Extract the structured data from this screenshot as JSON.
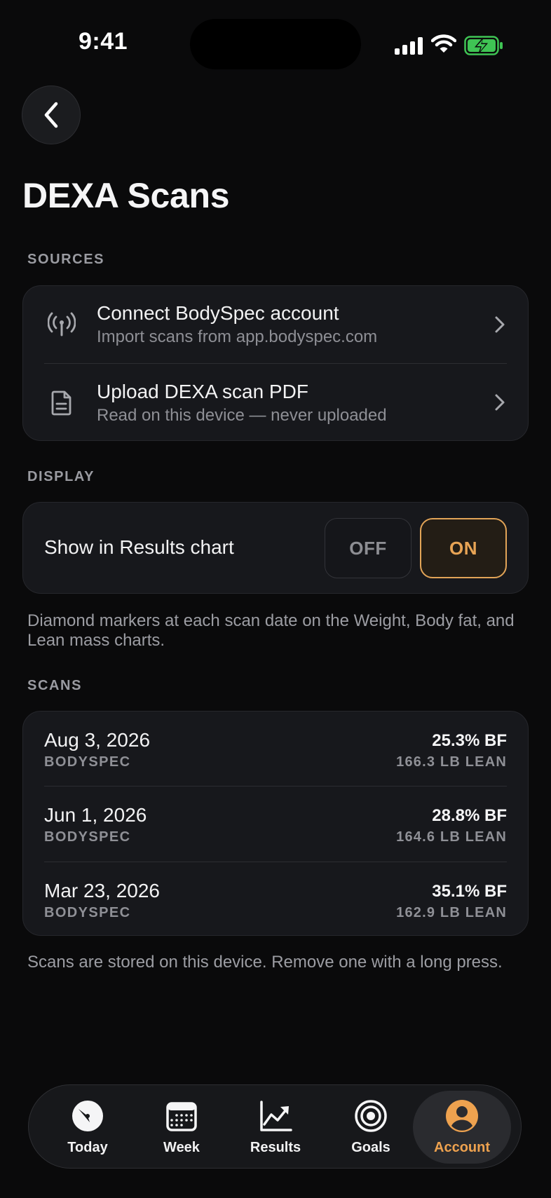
{
  "status_bar": {
    "time": "9:41"
  },
  "page": {
    "title": "DEXA Scans"
  },
  "sources": {
    "label": "SOURCES",
    "items": [
      {
        "icon": "antenna-icon",
        "title": "Connect BodySpec account",
        "subtitle": "Import scans from app.bodyspec.com"
      },
      {
        "icon": "document-icon",
        "title": "Upload DEXA scan PDF",
        "subtitle": "Read on this device — never uploaded"
      }
    ]
  },
  "display": {
    "label": "DISPLAY",
    "toggle_label": "Show in Results chart",
    "off_label": "OFF",
    "on_label": "ON",
    "selected": "ON",
    "note": "Diamond markers at each scan date on the Weight, Body fat, and Lean mass charts."
  },
  "scans": {
    "label": "SCANS",
    "items": [
      {
        "date": "Aug 3, 2026",
        "source": "BODYSPEC",
        "bf": "25.3% BF",
        "lean": "166.3 LB LEAN"
      },
      {
        "date": "Jun 1, 2026",
        "source": "BODYSPEC",
        "bf": "28.8% BF",
        "lean": "164.6 LB LEAN"
      },
      {
        "date": "Mar 23, 2026",
        "source": "BODYSPEC",
        "bf": "35.1% BF",
        "lean": "162.9 LB LEAN"
      }
    ],
    "note": "Scans are stored on this device. Remove one with a long press."
  },
  "tabbar": {
    "items": [
      {
        "label": "Today",
        "icon": "clock-icon"
      },
      {
        "label": "Week",
        "icon": "calendar-icon"
      },
      {
        "label": "Results",
        "icon": "chart-icon"
      },
      {
        "label": "Goals",
        "icon": "target-icon"
      },
      {
        "label": "Account",
        "icon": "person-icon"
      }
    ],
    "active": "Account"
  },
  "colors": {
    "accent": "#E8A455",
    "background": "#0A0A0B",
    "card": "#17181C"
  }
}
